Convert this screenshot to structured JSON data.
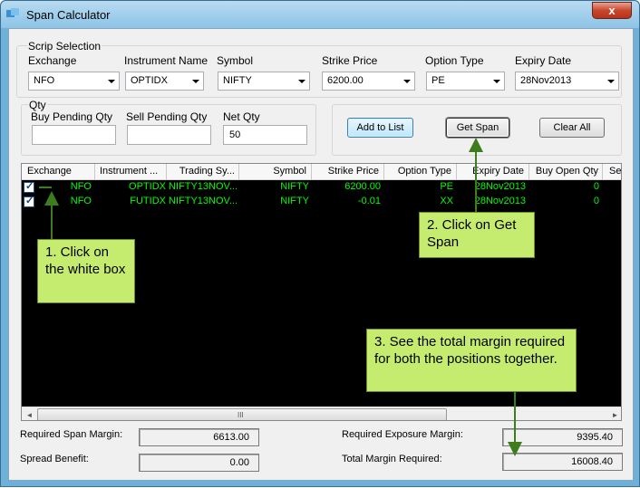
{
  "window": {
    "title": "Span Calculator",
    "close_label": "x"
  },
  "scrip_selection": {
    "group_title": "Scrip Selection",
    "fields": [
      {
        "label": "Exchange",
        "value": "NFO"
      },
      {
        "label": "Instrument Name",
        "value": "OPTIDX"
      },
      {
        "label": "Symbol",
        "value": "NIFTY"
      },
      {
        "label": "Strike Price",
        "value": "6200.00"
      },
      {
        "label": "Option Type",
        "value": "PE"
      },
      {
        "label": "Expiry Date",
        "value": "28Nov2013"
      }
    ]
  },
  "qty": {
    "group_title": "Qty",
    "buy_pending_label": "Buy Pending Qty",
    "buy_pending_value": "",
    "sell_pending_label": "Sell Pending Qty",
    "sell_pending_value": "",
    "net_qty_label": "Net Qty",
    "net_qty_value": "50"
  },
  "buttons": {
    "add_to_list": "Add to List",
    "get_span": "Get Span",
    "clear_all": "Clear All"
  },
  "grid": {
    "columns": [
      "Exchange",
      "Instrument ...",
      "Trading Sy...",
      "Symbol",
      "Strike Price",
      "Option Type",
      "Expiry Date",
      "Buy Open Qty",
      "Se"
    ],
    "rows": [
      {
        "checked": true,
        "exchange": "NFO",
        "instrument": "OPTIDX",
        "trading_symbol": "NIFTY13NOV...",
        "symbol": "NIFTY",
        "strike": "6200.00",
        "option_type": "PE",
        "expiry": "28Nov2013",
        "buy_open_qty": "0"
      },
      {
        "checked": true,
        "exchange": "NFO",
        "instrument": "FUTIDX",
        "trading_symbol": "NIFTY13NOV...",
        "symbol": "NIFTY",
        "strike": "-0.01",
        "option_type": "XX",
        "expiry": "28Nov2013",
        "buy_open_qty": "0"
      }
    ],
    "scroll_left": "◄",
    "scroll_right": "►",
    "scroll_grip": "III"
  },
  "totals": {
    "required_span_margin_label": "Required Span Margin:",
    "required_span_margin": "6613.00",
    "spread_benefit_label": "Spread Benefit:",
    "spread_benefit": "0.00",
    "required_exposure_margin_label": "Required Exposure Margin:",
    "required_exposure_margin": "9395.40",
    "total_margin_required_label": "Total Margin Required:",
    "total_margin_required": "16008.40"
  },
  "callouts": {
    "step1": "1. Click on the white box",
    "step2": "2. Click on Get Span",
    "step3": "3. See the total margin required for both the positions together."
  },
  "colors": {
    "grid_text": "#00ff00",
    "grid_bg": "#000000",
    "callout_bg": "#c6ec6f",
    "arrow": "#3e7d1e"
  }
}
